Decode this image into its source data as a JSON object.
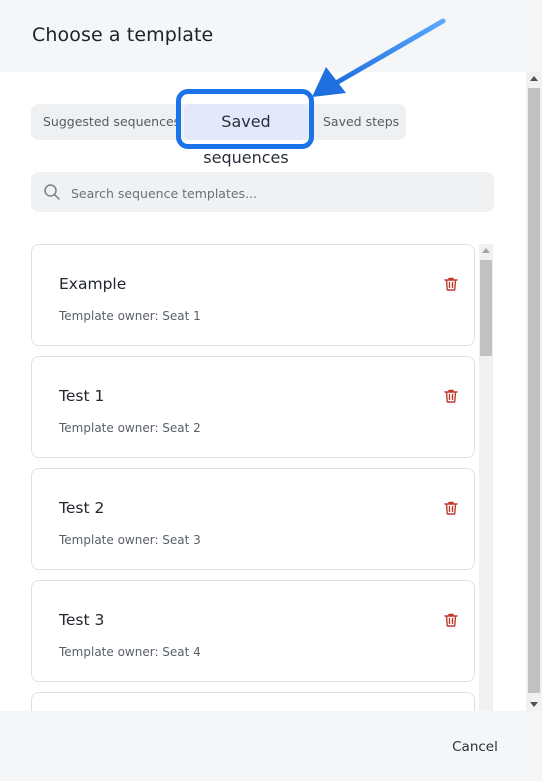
{
  "dialog": {
    "title": "Choose a template"
  },
  "tabs": [
    {
      "label": "Suggested sequences",
      "selected": false
    },
    {
      "label": "Saved sequences",
      "selected": true
    },
    {
      "label": "Saved steps",
      "selected": false
    }
  ],
  "search": {
    "placeholder": "Search sequence templates...",
    "value": ""
  },
  "templates": [
    {
      "name": "Example",
      "owner": "Template owner: Seat 1"
    },
    {
      "name": "Test 1",
      "owner": "Template owner: Seat 2"
    },
    {
      "name": "Test 2",
      "owner": "Template owner: Seat 3"
    },
    {
      "name": "Test 3",
      "owner": "Template owner: Seat 4"
    },
    {
      "name": "",
      "owner": ""
    }
  ],
  "footer": {
    "cancel_label": "Cancel"
  },
  "colors": {
    "accent_highlight": "#1a73e8",
    "selected_tab_bg": "#e3e8fb",
    "trash_icon": "#c0392b",
    "header_bg": "#f5f6f7"
  },
  "icons": {
    "search": "search-icon",
    "delete": "trash-icon",
    "annotation": "arrow-icon"
  }
}
